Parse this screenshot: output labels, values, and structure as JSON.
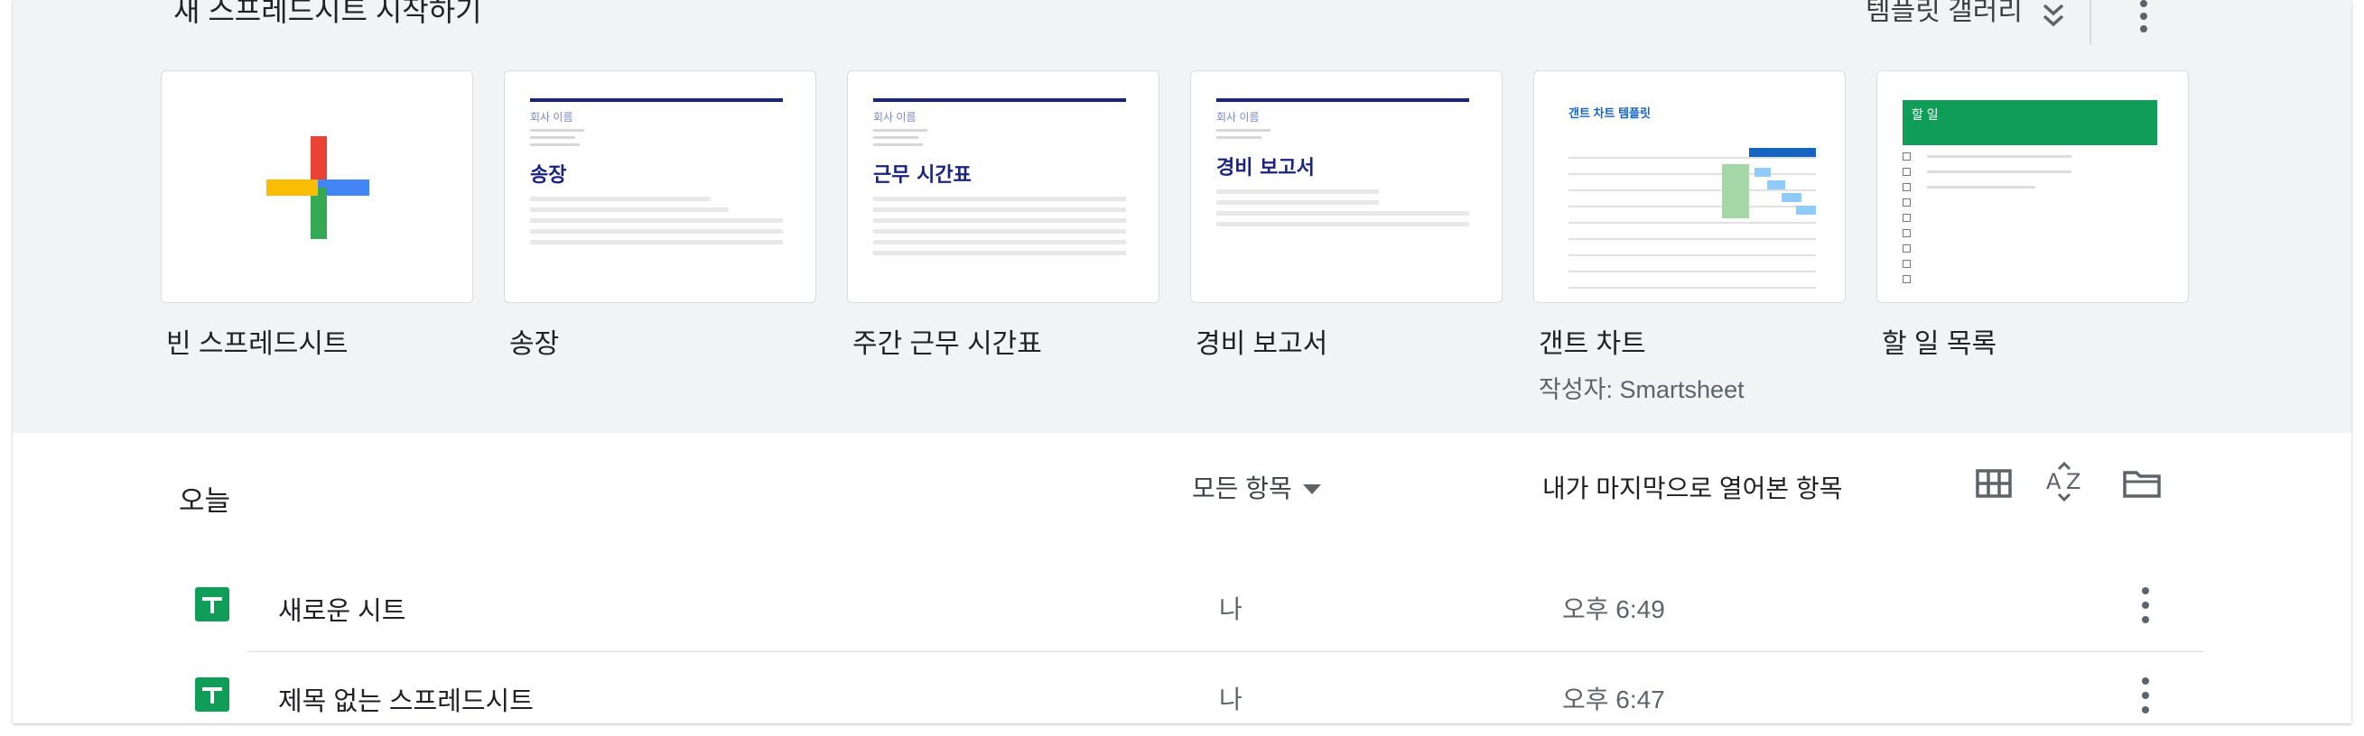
{
  "template_section": {
    "title": "새 스프레드시트 시작하기",
    "gallery_label": "템플릿 갤러리",
    "templates": [
      {
        "label": "빈 스프레드시트",
        "subtitle": ""
      },
      {
        "label": "송장",
        "subtitle": "",
        "thumb_heading": "송장",
        "thumb_company": "회사 이름"
      },
      {
        "label": "주간 근무 시간표",
        "subtitle": "",
        "thumb_heading": "근무 시간표",
        "thumb_company": "회사 이름"
      },
      {
        "label": "경비 보고서",
        "subtitle": "",
        "thumb_heading": "경비 보고서",
        "thumb_company": "회사 이름"
      },
      {
        "label": "갠트 차트",
        "subtitle": "작성자: Smartsheet",
        "thumb_heading": "갠트 차트 템플릿"
      },
      {
        "label": "할 일 목록",
        "subtitle": "",
        "thumb_heading": "할 일"
      }
    ]
  },
  "list": {
    "section_label": "오늘",
    "owner_filter": "모든 항목",
    "sort_label": "내가 마지막으로 열어본 항목",
    "files": [
      {
        "name": "새로운 시트",
        "owner": "나",
        "time": "오후 6:49"
      },
      {
        "name": "제목 없는 스프레드시트",
        "owner": "나",
        "time": "오후 6:47"
      }
    ]
  },
  "colors": {
    "sheets_green": "#0f9d58",
    "header_bg": "#f1f3f4",
    "google_red": "#ea4335",
    "google_blue": "#4285f4",
    "google_yellow": "#fbbc04",
    "google_green": "#34a853"
  },
  "icons": [
    "expand-icon",
    "more-vert-icon",
    "grid-view-icon",
    "sort-az-icon",
    "folder-icon",
    "sheets-file-icon",
    "plus-icon"
  ]
}
